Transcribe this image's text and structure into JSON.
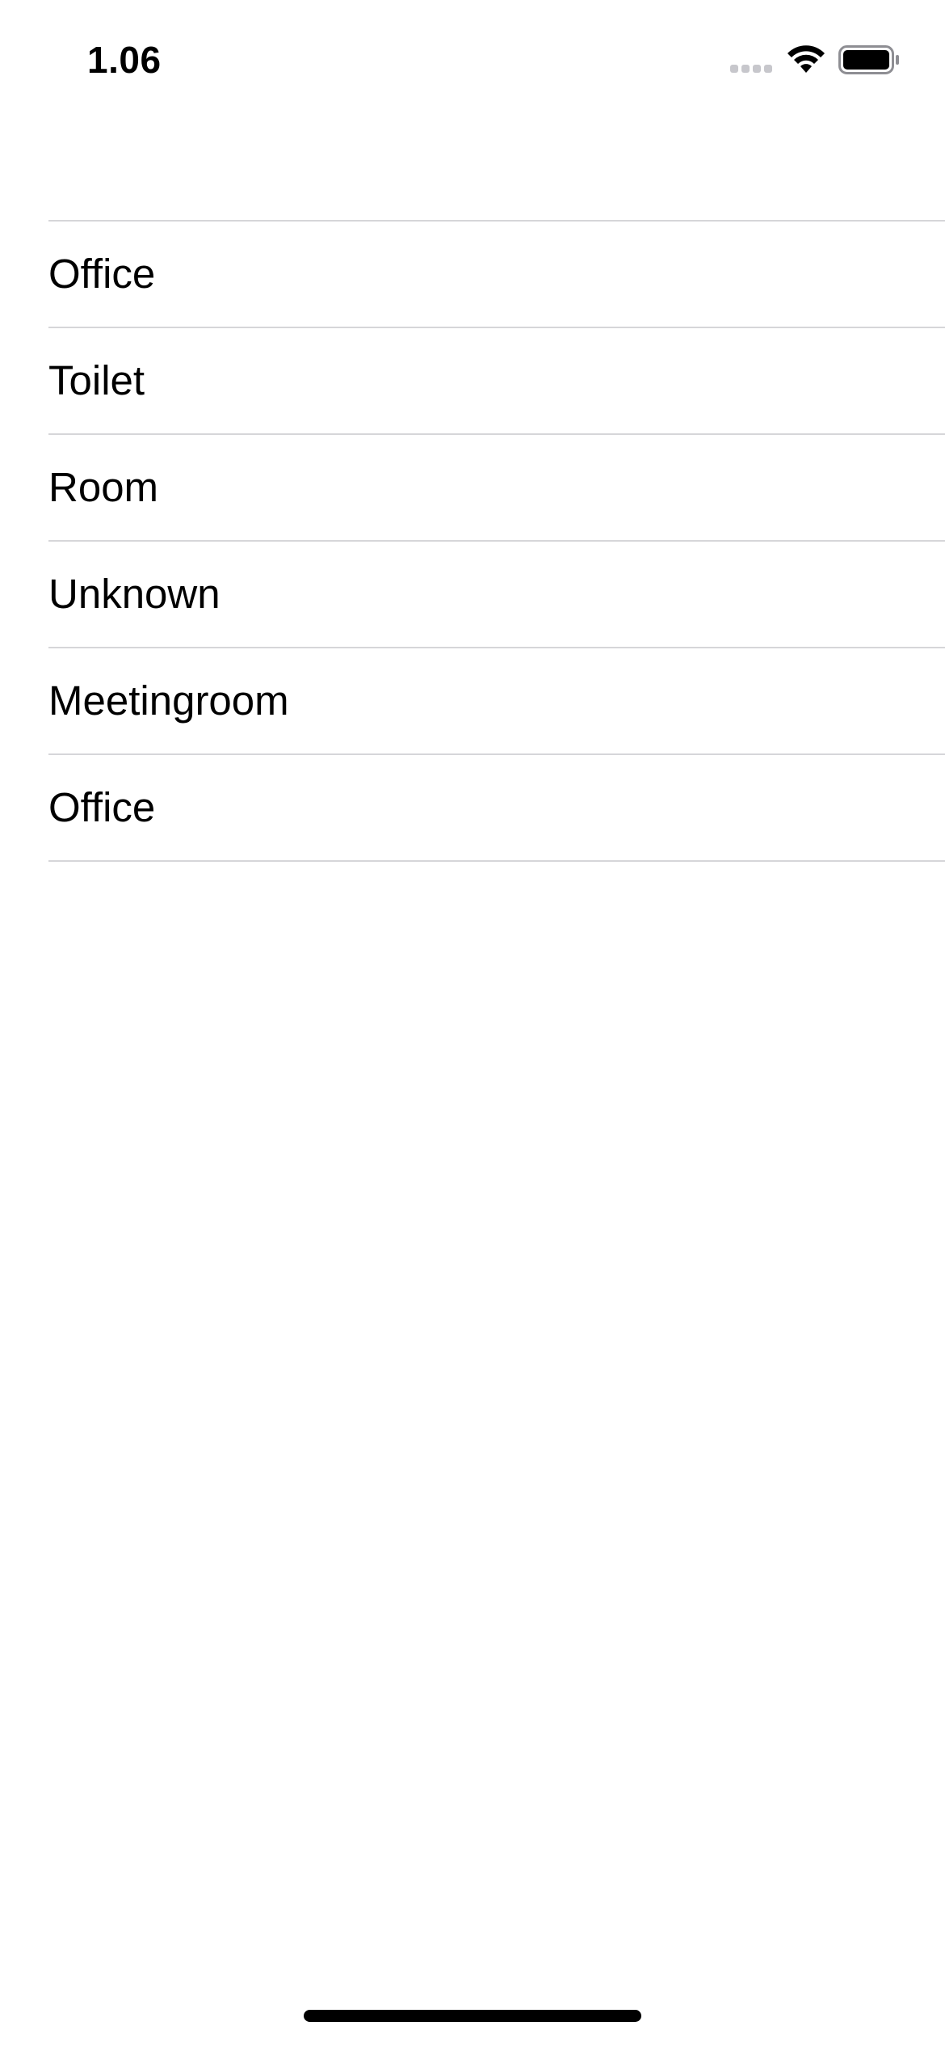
{
  "status_bar": {
    "time": "1.06",
    "icons": [
      "cellular-signal-icon",
      "wifi-icon",
      "battery-icon"
    ]
  },
  "list": {
    "items": [
      {
        "label": "Office"
      },
      {
        "label": "Toilet"
      },
      {
        "label": "Room"
      },
      {
        "label": "Unknown"
      },
      {
        "label": "Meetingroom"
      },
      {
        "label": "Office"
      }
    ]
  },
  "colors": {
    "background": "#ffffff",
    "text": "#000000",
    "separator": "#d6d6d9",
    "inactive_signal": "#c7c7cc"
  }
}
